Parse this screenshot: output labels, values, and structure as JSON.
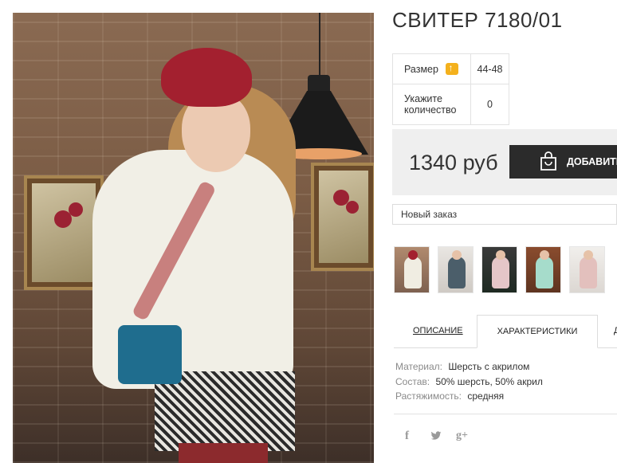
{
  "product": {
    "title": "СВИТЕР 7180/01",
    "options": [
      {
        "label": "Размер",
        "value": "44-48",
        "icon": "size-chart-icon"
      },
      {
        "label": "Укажите количество",
        "value": "0"
      }
    ],
    "price": "1340 руб",
    "add_button_label": "ДОБАВИТЬ",
    "order_select_value": "Новый заказ"
  },
  "tabs": [
    {
      "label": "ОПИСАНИЕ"
    },
    {
      "label": "ХАРАКТЕРИСТИКИ"
    },
    {
      "label": "Д"
    }
  ],
  "characteristics": [
    {
      "key": "Материал:",
      "value": "Шерсть с акрилом"
    },
    {
      "key": "Состав:",
      "value": "50% шерсть, 50% акрил"
    },
    {
      "key": "Растяжимость:",
      "value": "средняя"
    }
  ],
  "social": {
    "facebook": "f",
    "twitter": "🐦",
    "google_plus": "g+"
  },
  "colors": {
    "button_bg": "#2b2b2b",
    "price_box_bg": "#efefef",
    "size_icon": "#f4b11d"
  }
}
